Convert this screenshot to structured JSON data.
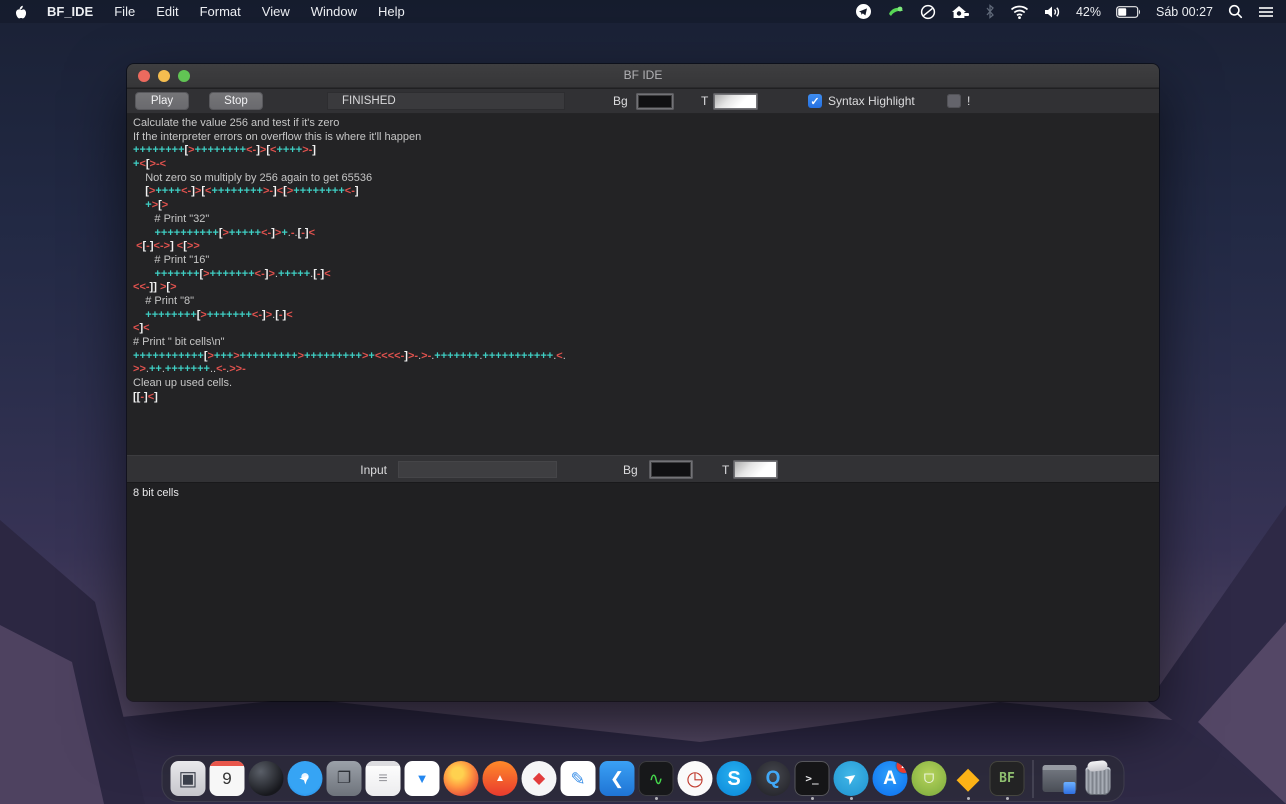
{
  "menubar": {
    "items": [
      "BF_IDE",
      "File",
      "Edit",
      "Format",
      "View",
      "Window",
      "Help"
    ],
    "status": {
      "battery_pct": "42%",
      "clock": "Sáb 00:27"
    },
    "status_icon_names": [
      "telegram-status-icon",
      "green-app-status-icon",
      "do-not-disturb-icon",
      "home-icon",
      "bluetooth-icon",
      "wifi-icon",
      "volume-icon",
      "battery-icon",
      "spotlight-search-icon",
      "notification-center-icon"
    ]
  },
  "window": {
    "title": "BF IDE",
    "toolbar": {
      "play_label": "Play",
      "stop_label": "Stop",
      "status_text": "FINISHED",
      "bg_label": "Bg",
      "t_label": "T",
      "syntax_label": "Syntax Highlight",
      "syntax_checked": true,
      "bang_label": "!",
      "bang_checked": false,
      "bg_swatch_color": "#101012",
      "t_swatch_color": "#ffffff"
    },
    "editor": {
      "lines": [
        {
          "t": "c",
          "s": "Calculate the value 256 and test if it's zero"
        },
        {
          "t": "c",
          "s": "If the interpreter errors on overflow this is where it'll happen"
        },
        {
          "t": "b",
          "s": "++++++++[>++++++++<-]>[<++++>-]"
        },
        {
          "t": "b",
          "s": "+<[>-<"
        },
        {
          "t": "c",
          "s": "    Not zero so multiply by 256 again to get 65536"
        },
        {
          "t": "b",
          "s": "    [>++++<-]>[<++++++++>-]<[>++++++++<-]"
        },
        {
          "t": "b",
          "s": "    +>[>"
        },
        {
          "t": "c",
          "s": "       # Print \"32\""
        },
        {
          "t": "b",
          "s": "       ++++++++++[>+++++<-]>+.-.[-]<"
        },
        {
          "t": "b",
          "s": " <[-]<->] <[>>"
        },
        {
          "t": "c",
          "s": "       # Print \"16\""
        },
        {
          "t": "b",
          "s": "       +++++++[>+++++++<-]>.+++++.[-]<"
        },
        {
          "t": "b",
          "s": "<<-]] >[>"
        },
        {
          "t": "c",
          "s": "    # Print \"8\""
        },
        {
          "t": "b",
          "s": "    ++++++++[>+++++++<-]>.[-]<"
        },
        {
          "t": "b",
          "s": "<]<"
        },
        {
          "t": "c",
          "s": "# Print \" bit cells\\n\""
        },
        {
          "t": "b",
          "s": "+++++++++++[>+++>+++++++++>+++++++++>+<<<<-]>-.>-.+++++++.+++++++++++.<."
        },
        {
          "t": "b",
          "s": ">>.++.+++++++..<-.>>-"
        },
        {
          "t": "c",
          "s": "Clean up used cells."
        },
        {
          "t": "b",
          "s": "[[-]<]"
        }
      ]
    },
    "input_row": {
      "label": "Input",
      "value": "",
      "bg_label": "Bg",
      "t_label": "T"
    },
    "output": {
      "text": "8 bit cells"
    }
  },
  "colors": {
    "plus": "#3fcfc4",
    "minus": "#e0524e",
    "bracket": "#f2f2f2",
    "dot": "#c9c9c9",
    "comment": "#c6c6c6",
    "accent_checkbox": "#2e7de6"
  },
  "dock": {
    "items": [
      {
        "name": "display-app-icon",
        "type": "app",
        "shape": "rounded",
        "bg": "linear-gradient(#e9e9ec,#c6c6cb)",
        "glyph": "▣",
        "glyph_color": "#3a3f4a",
        "glyph_size": 20
      },
      {
        "name": "calendar-icon",
        "type": "app",
        "shape": "rounded",
        "bg": "#f7f7f7",
        "stripe": "#e8564b",
        "glyph": "9",
        "glyph_color": "#333333",
        "glyph_size": 17
      },
      {
        "name": "dark-sphere-app-icon",
        "type": "app",
        "shape": "circle",
        "bg": "radial-gradient(circle at 35% 30%, #5a5f68, #17181d 72%)"
      },
      {
        "name": "safari-icon",
        "type": "app",
        "shape": "circle",
        "bg": "radial-gradient(circle at 50% 45%, #eaf5ff 0 13%, #36a4f4 15% 62%, #1b7fe0 100%)",
        "glyph": "➤",
        "glyph_color": "#ffffff",
        "glyph_size": 13,
        "rotate": -45
      },
      {
        "name": "screenshot-window-app-icon",
        "type": "app",
        "shape": "rounded",
        "bg": "linear-gradient(#9ba1a9,#6e737b)",
        "glyph": "❐",
        "glyph_color": "#2e3238",
        "glyph_size": 16
      },
      {
        "name": "notes-app-icon",
        "type": "app",
        "shape": "rounded",
        "bg": "linear-gradient(#ffffff,#ececee)",
        "stripe": "#dcdce0",
        "glyph": "≡",
        "glyph_color": "#9a9aa0",
        "glyph_size": 16
      },
      {
        "name": "presentation-app-icon",
        "type": "app",
        "shape": "rounded",
        "bg": "#ffffff",
        "glyph": "▼",
        "glyph_color": "#2387f0",
        "glyph_size": 13
      },
      {
        "name": "firefox-icon",
        "type": "app",
        "shape": "circle",
        "bg": "radial-gradient(circle at 40% 35%, #ffd14f 0 18%, #ff9640 45%, #e8533c 75%, #b93f8e 100%)"
      },
      {
        "name": "brave-browser-icon",
        "type": "app",
        "shape": "circle",
        "bg": "linear-gradient(#ff8a2a,#e93a2e)",
        "glyph": "▲",
        "glyph_color": "#ffffff",
        "glyph_size": 10
      },
      {
        "name": "red-emblem-app-icon",
        "type": "app",
        "shape": "circle",
        "bg": "#f5f5f7",
        "glyph": "◆",
        "glyph_color": "#e23c3c",
        "glyph_size": 16
      },
      {
        "name": "pencil-editor-app-icon",
        "type": "app",
        "shape": "rounded",
        "bg": "#ffffff",
        "glyph": "✎",
        "glyph_color": "#3a8fe8",
        "glyph_size": 18
      },
      {
        "name": "vscode-icon",
        "type": "app",
        "shape": "rounded",
        "bg": "linear-gradient(#3aa0f5,#1f74d4)",
        "glyph": "❮",
        "glyph_color": "#ffffff",
        "glyph_size": 17
      },
      {
        "name": "activity-monitor-icon",
        "type": "app",
        "shape": "rounded",
        "bg": "#17181a",
        "border": "#3c3c40",
        "glyph": "∿",
        "glyph_color": "#45d74c",
        "glyph_size": 18,
        "running": true
      },
      {
        "name": "clock-dial-app-icon",
        "type": "app",
        "shape": "circle",
        "bg": "#fafafa",
        "glyph": "◷",
        "glyph_color": "#c03b2e",
        "glyph_size": 20
      },
      {
        "name": "skype-icon",
        "type": "app",
        "shape": "circle",
        "bg": "radial-gradient(circle at 50% 40%, #27b0f0, #0a87d8)",
        "glyph": "S",
        "glyph_color": "#ffffff",
        "glyph_size": 20,
        "bold": true
      },
      {
        "name": "quicktime-icon",
        "type": "app",
        "shape": "circle",
        "bg": "radial-gradient(circle at 50% 40%, #46484f, #1f1f25)",
        "glyph": "Q",
        "glyph_color": "#41a8f7",
        "glyph_size": 19,
        "bold": true
      },
      {
        "name": "terminal-icon",
        "type": "app",
        "shape": "rounded",
        "bg": "#151517",
        "border": "#56565c",
        "glyph": ">_",
        "glyph_color": "#e8e8ea",
        "glyph_size": 11,
        "mono": true,
        "bold": true,
        "running": true
      },
      {
        "name": "telegram-icon",
        "type": "app",
        "shape": "circle",
        "bg": "radial-gradient(circle at 50% 40%, #41b7e8, #1f93d0)",
        "glyph": "➤",
        "glyph_color": "#ffffff",
        "glyph_size": 15,
        "rotate": -35,
        "running": true
      },
      {
        "name": "app-store-icon",
        "type": "app",
        "shape": "circle",
        "bg": "radial-gradient(circle at 50% 40%, #2da0fa, #0c6ef0)",
        "glyph": "A",
        "glyph_color": "#ffffff",
        "glyph_size": 19,
        "bold": true,
        "badge": "2"
      },
      {
        "name": "android-studio-icon",
        "type": "app",
        "shape": "circle",
        "bg": "radial-gradient(circle at 50% 40%, #b6d35c, #79a93b)",
        "glyph": "ᗜ",
        "glyph_color": "#e9f3d8",
        "glyph_size": 13
      },
      {
        "name": "sketch-icon",
        "type": "app",
        "shape": "plain",
        "glyph": "◆",
        "glyph_color": "#fcb216",
        "glyph_size": 30,
        "running": true
      },
      {
        "name": "bf-ide-dock-icon",
        "type": "app",
        "shape": "rounded",
        "bg": "#232324",
        "border": "#45453f",
        "glyph": "BF",
        "glyph_color": "#8fbf6f",
        "glyph_size": 13,
        "mono": true,
        "bold": true,
        "running": true
      },
      {
        "name": "dock-separator",
        "type": "sep"
      },
      {
        "name": "minimized-window-thumb",
        "type": "thumb"
      },
      {
        "name": "trash-icon",
        "type": "trash"
      }
    ]
  }
}
